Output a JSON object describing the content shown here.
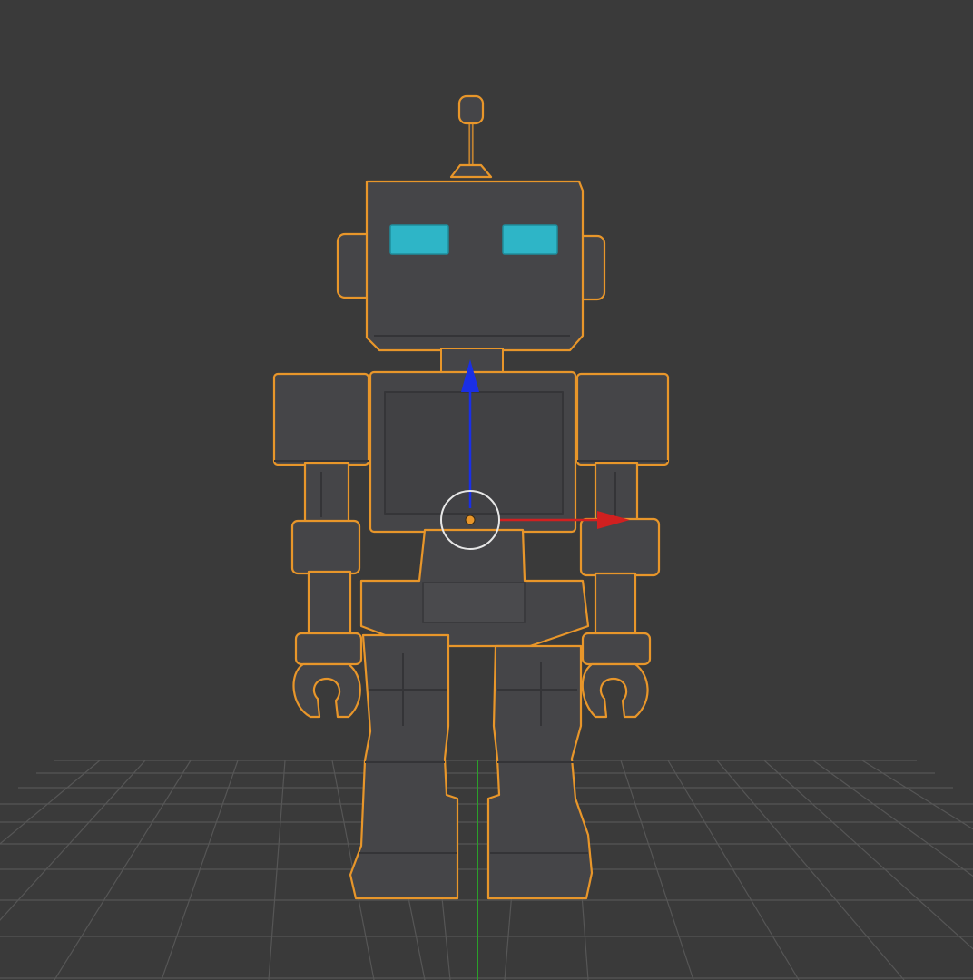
{
  "viewport": {
    "background": "#3a3a3a",
    "grid_color": "#565656",
    "y_axis_color": "#2aa02a"
  },
  "object": {
    "name": "robot",
    "body_color": "#454548",
    "body_shade": "#3a3a3d",
    "selection_outline": "#e8962a",
    "eye_color": "#2eb5c7",
    "selected": true
  },
  "transform_gizmo": {
    "x_axis_color": "#d12020",
    "z_axis_color": "#1a2fe6",
    "pivot_ring_color": "#e6e6e6",
    "origin_color": "#e8962a"
  },
  "icons": [
    "move-gizmo-icon",
    "origin-pivot-icon"
  ]
}
